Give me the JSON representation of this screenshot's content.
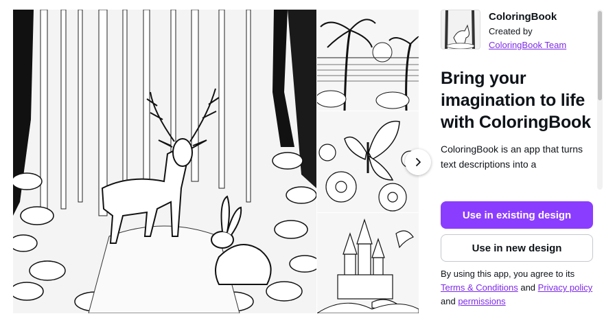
{
  "app": {
    "name": "ColoringBook",
    "created_by_label": "Created by",
    "creator": "ColoringBook Team"
  },
  "headline": "Bring your imagination to life with ColoringBook",
  "description": "ColoringBook is an app that turns text descriptions into a",
  "buttons": {
    "primary": "Use in existing design",
    "secondary": "Use in new design"
  },
  "legal": {
    "prefix": "By using this app, you agree to its",
    "terms": "Terms & Conditions",
    "and1": "and",
    "privacy": "Privacy policy",
    "and2": "and",
    "permissions": "permissions"
  },
  "gallery": {
    "main_image": "deer-and-rabbit-forest-coloring-page",
    "thumbnails": [
      "palm-beach-sunset-coloring-page",
      "butterfly-flowers-coloring-page",
      "castle-dragon-coloring-page"
    ]
  },
  "icons": {
    "next": "chevron-right-icon"
  },
  "colors": {
    "accent": "#8b3dff",
    "link": "#7d2ae8"
  }
}
